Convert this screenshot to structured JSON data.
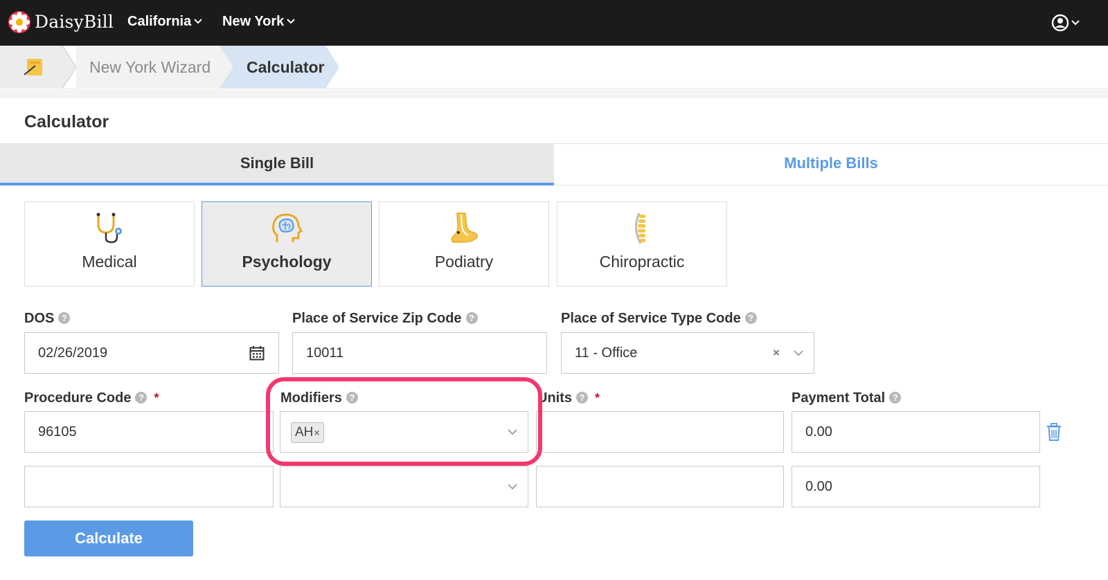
{
  "nav": {
    "brand": "DaisyBill",
    "menus": [
      {
        "label": "California"
      },
      {
        "label": "New York"
      }
    ]
  },
  "breadcrumb": {
    "items": [
      "New York Wizard",
      "Calculator"
    ]
  },
  "page": {
    "title": "Calculator"
  },
  "tabs": {
    "single": "Single Bill",
    "multiple": "Multiple Bills"
  },
  "categories": [
    {
      "label": "Medical",
      "icon": "stethoscope-icon"
    },
    {
      "label": "Psychology",
      "icon": "brain-icon",
      "selected": true
    },
    {
      "label": "Podiatry",
      "icon": "foot-icon"
    },
    {
      "label": "Chiropractic",
      "icon": "spine-icon"
    }
  ],
  "form": {
    "dos": {
      "label": "DOS",
      "value": "02/26/2019"
    },
    "zip": {
      "label": "Place of Service Zip Code",
      "value": "10011"
    },
    "type_code": {
      "label": "Place of Service Type Code",
      "value": "11 - Office"
    },
    "procedure": {
      "label": "Procedure Code"
    },
    "modifiers": {
      "label": "Modifiers"
    },
    "units": {
      "label": "Units"
    },
    "payment": {
      "label": "Payment Total"
    },
    "rows": [
      {
        "procedure": "96105",
        "modifier_tag": "AH",
        "units": "",
        "payment": "0.00"
      },
      {
        "procedure": "",
        "modifier_tag": "",
        "units": "",
        "payment": "0.00"
      }
    ],
    "required_mark": "*",
    "help_mark": "?",
    "calculate": "Calculate"
  },
  "colors": {
    "accent": "#5b9be6",
    "highlight": "#f2386f",
    "nav_bg": "#1b1b1b"
  }
}
